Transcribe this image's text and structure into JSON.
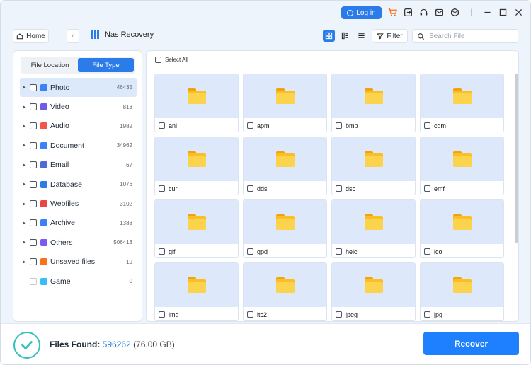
{
  "titlebar": {
    "login_label": "Log in",
    "icons": [
      "cart-icon",
      "export-icon",
      "headset-icon",
      "mail-icon",
      "cube-icon",
      "minimize-icon",
      "maximize-icon",
      "close-icon"
    ],
    "accent": "#2b7ce9"
  },
  "nav": {
    "home_label": "Home",
    "breadcrumb": "Nas Recovery",
    "filter_label": "Filter",
    "search_placeholder": "Search File"
  },
  "left_panel": {
    "tabs": [
      {
        "label": "File Location",
        "active": false
      },
      {
        "label": "File Type",
        "active": true
      }
    ],
    "tree": [
      {
        "label": "Photo",
        "count": "46435",
        "selected": true,
        "icon": "photo-icon",
        "color": "#3b82f6"
      },
      {
        "label": "Video",
        "count": "818",
        "selected": false,
        "icon": "video-icon",
        "color": "#6d5ce8"
      },
      {
        "label": "Audio",
        "count": "1982",
        "selected": false,
        "icon": "audio-icon",
        "color": "#f0564a"
      },
      {
        "label": "Document",
        "count": "34962",
        "selected": false,
        "icon": "document-icon",
        "color": "#3b82f6"
      },
      {
        "label": "Email",
        "count": "67",
        "selected": false,
        "icon": "email-icon",
        "color": "#4f6bd8"
      },
      {
        "label": "Database",
        "count": "1076",
        "selected": false,
        "icon": "database-icon",
        "color": "#2b7ce9"
      },
      {
        "label": "Webfiles",
        "count": "3102",
        "selected": false,
        "icon": "webfiles-icon",
        "color": "#ef4444"
      },
      {
        "label": "Archive",
        "count": "1388",
        "selected": false,
        "icon": "archive-icon",
        "color": "#3b82f6"
      },
      {
        "label": "Others",
        "count": "506413",
        "selected": false,
        "icon": "others-icon",
        "color": "#7c5cf0"
      },
      {
        "label": "Unsaved files",
        "count": "19",
        "selected": false,
        "icon": "unsaved-icon",
        "color": "#f97316"
      },
      {
        "label": "Game",
        "count": "0",
        "selected": false,
        "icon": "game-icon",
        "color": "#38bdf8"
      }
    ]
  },
  "right_panel": {
    "select_all_label": "Select All",
    "folders": [
      "ani",
      "apm",
      "bmp",
      "cgm",
      "cur",
      "dds",
      "dsc",
      "emf",
      "gif",
      "gpd",
      "heic",
      "ico",
      "img",
      "itc2",
      "jpeg",
      "jpg"
    ]
  },
  "footer": {
    "files_found_label": "Files Found:",
    "files_found_count": "596262",
    "files_found_size": "(76.00 GB)",
    "recover_label": "Recover"
  }
}
